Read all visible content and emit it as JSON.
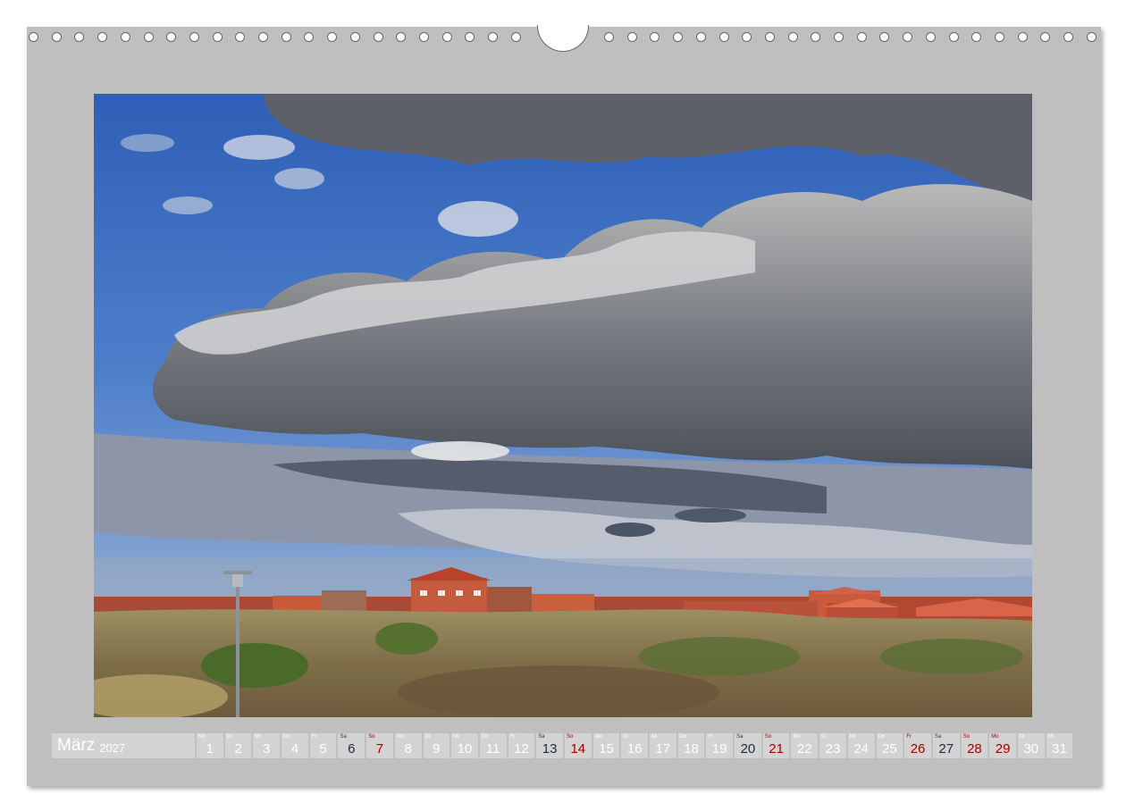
{
  "calendar": {
    "month": "März",
    "year": "2027",
    "days": [
      {
        "wd": "Mo",
        "n": "1",
        "t": "w"
      },
      {
        "wd": "Di",
        "n": "2",
        "t": "w"
      },
      {
        "wd": "Mi",
        "n": "3",
        "t": "w"
      },
      {
        "wd": "Do",
        "n": "4",
        "t": "w"
      },
      {
        "wd": "Fr",
        "n": "5",
        "t": "w"
      },
      {
        "wd": "Sa",
        "n": "6",
        "t": "sat"
      },
      {
        "wd": "So",
        "n": "7",
        "t": "sun"
      },
      {
        "wd": "Mo",
        "n": "8",
        "t": "w"
      },
      {
        "wd": "Di",
        "n": "9",
        "t": "w"
      },
      {
        "wd": "Mi",
        "n": "10",
        "t": "w"
      },
      {
        "wd": "Do",
        "n": "11",
        "t": "w"
      },
      {
        "wd": "Fr",
        "n": "12",
        "t": "w"
      },
      {
        "wd": "Sa",
        "n": "13",
        "t": "sat"
      },
      {
        "wd": "So",
        "n": "14",
        "t": "sun"
      },
      {
        "wd": "Mo",
        "n": "15",
        "t": "w"
      },
      {
        "wd": "Di",
        "n": "16",
        "t": "w"
      },
      {
        "wd": "Mi",
        "n": "17",
        "t": "w"
      },
      {
        "wd": "Do",
        "n": "18",
        "t": "w"
      },
      {
        "wd": "Fr",
        "n": "19",
        "t": "w"
      },
      {
        "wd": "Sa",
        "n": "20",
        "t": "sat"
      },
      {
        "wd": "So",
        "n": "21",
        "t": "sun"
      },
      {
        "wd": "Mo",
        "n": "22",
        "t": "w"
      },
      {
        "wd": "Di",
        "n": "23",
        "t": "w"
      },
      {
        "wd": "Mi",
        "n": "24",
        "t": "w"
      },
      {
        "wd": "Do",
        "n": "25",
        "t": "w"
      },
      {
        "wd": "Fr",
        "n": "26",
        "t": "sun"
      },
      {
        "wd": "Sa",
        "n": "27",
        "t": "sat"
      },
      {
        "wd": "So",
        "n": "28",
        "t": "sun"
      },
      {
        "wd": "Mo",
        "n": "29",
        "t": "sun"
      },
      {
        "wd": "Di",
        "n": "30",
        "t": "w"
      },
      {
        "wd": "Mi",
        "n": "31",
        "t": "w"
      }
    ]
  },
  "colors": {
    "frame": "#bfbfbf",
    "cell": "#d3d3d3",
    "saturday": "#1e2a44",
    "holiday": "#a00000"
  },
  "icons": {
    "binding": "wire-binding-hole",
    "hanger": "calendar-hanger-notch"
  }
}
